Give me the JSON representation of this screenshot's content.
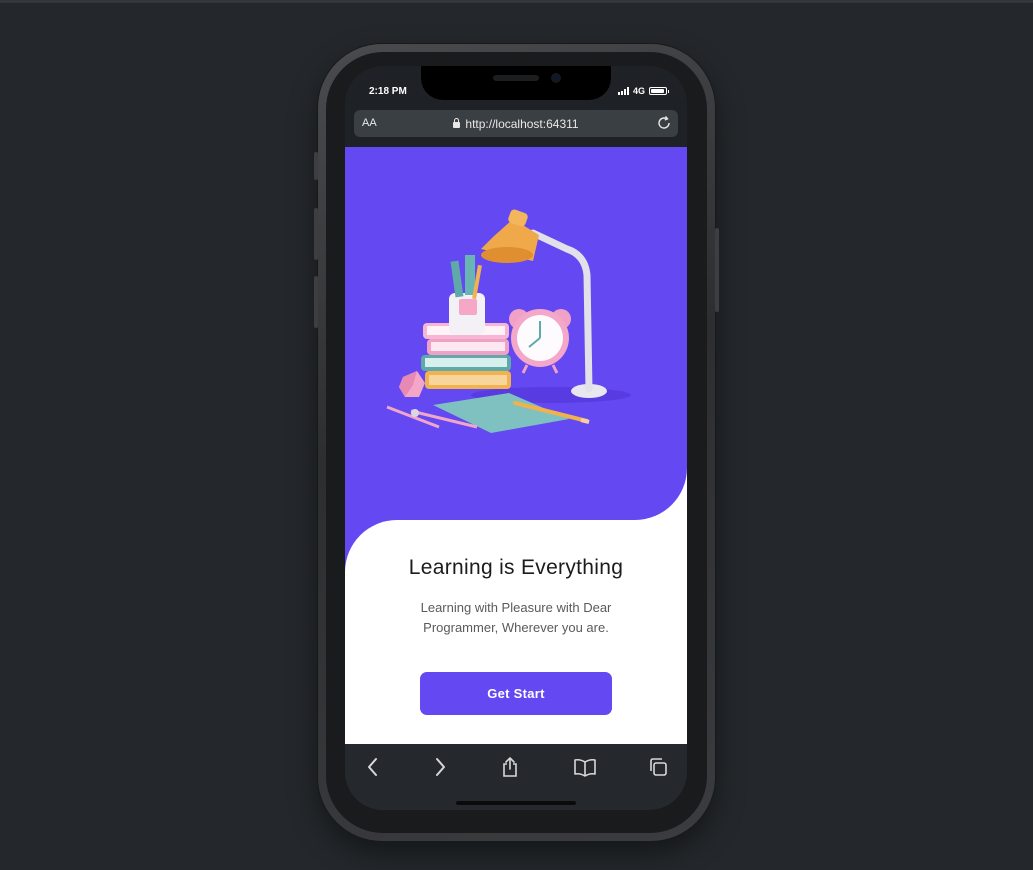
{
  "status_bar": {
    "time": "2:18 PM",
    "network": "4G",
    "battery_level": 0.9
  },
  "browser": {
    "text_size_label": "AA",
    "url": "http://localhost:64311",
    "reload_icon": "reload-icon",
    "lock_icon": "lock-icon"
  },
  "hero": {
    "background_color": "#6448f2",
    "illustration": "study-desk-illustration"
  },
  "main": {
    "title": "Learning is Everything",
    "subtitle": "Learning with Pleasure with Dear Programmer, Wherever you are.",
    "cta_label": "Get Start",
    "accent_color": "#6448f2"
  },
  "toolbar": {
    "icons": [
      "back-icon",
      "forward-icon",
      "share-icon",
      "bookmarks-icon",
      "tabs-icon"
    ]
  }
}
